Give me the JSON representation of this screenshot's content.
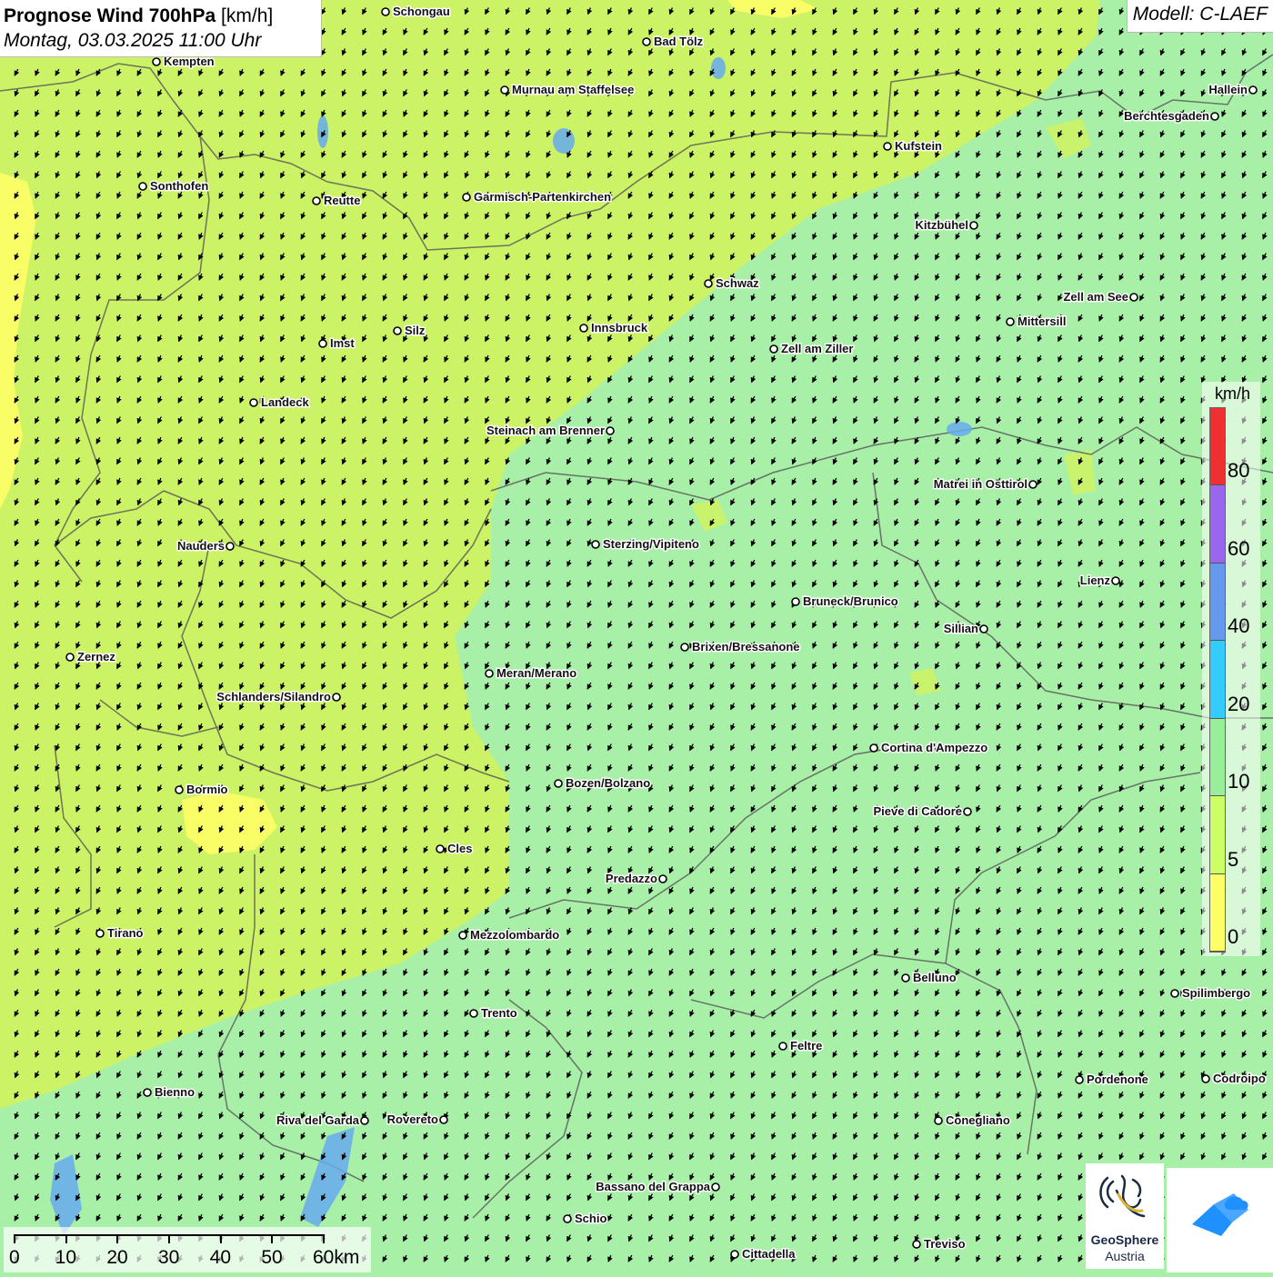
{
  "header": {
    "title_bold": "Prognose Wind 700hPa",
    "title_unit": " [km/h]",
    "subtitle": "Montag, 03.03.2025 11:00 Uhr",
    "model": "Modell: C-LAEF"
  },
  "legend": {
    "unit": "km/h",
    "ticks": [
      "80",
      "60",
      "40",
      "20",
      "10",
      "5",
      "0"
    ],
    "colors": [
      "#f03030",
      "#9966ee",
      "#6699ee",
      "#33ccff",
      "#99ee99",
      "#ccff66",
      "#ffff66"
    ]
  },
  "scalebar": {
    "labels": [
      "0",
      "10",
      "20",
      "30",
      "40",
      "50",
      "60km"
    ]
  },
  "logos": {
    "geosphere_name": "GeoSphere",
    "geosphere_sub": "Austria"
  },
  "map": {
    "background_colors": {
      "calm": "#ccf266",
      "light": "#ffff66",
      "moderate": "#a8f0a8"
    },
    "wind_direction": "from north-northeast (arrows point south-southwest)",
    "cities": [
      {
        "name": "Schongau"
      },
      {
        "name": "Bad Tölz"
      },
      {
        "name": "Kempten"
      },
      {
        "name": "Murnau am Staffelsee"
      },
      {
        "name": "Hallein"
      },
      {
        "name": "Berchtesgaden"
      },
      {
        "name": "Kufstein"
      },
      {
        "name": "Sonthofen"
      },
      {
        "name": "Reutte"
      },
      {
        "name": "Garmisch-Partenkirchen"
      },
      {
        "name": "Kitzbühel"
      },
      {
        "name": "Schwaz"
      },
      {
        "name": "Zell am See"
      },
      {
        "name": "Mittersill"
      },
      {
        "name": "Innsbruck"
      },
      {
        "name": "Silz"
      },
      {
        "name": "Imst"
      },
      {
        "name": "Zell am Ziller"
      },
      {
        "name": "Landeck"
      },
      {
        "name": "Steinach am Brenner"
      },
      {
        "name": "Matrei in Osttirol"
      },
      {
        "name": "Nauders"
      },
      {
        "name": "Sterzing/Vipiteno"
      },
      {
        "name": "Lienz"
      },
      {
        "name": "Bruneck/Brunico"
      },
      {
        "name": "Sillian"
      },
      {
        "name": "Brixen/Bressanone"
      },
      {
        "name": "Zernez"
      },
      {
        "name": "Meran/Merano"
      },
      {
        "name": "Schlanders/Silandro"
      },
      {
        "name": "Cortina d'Ampezzo"
      },
      {
        "name": "Bozen/Bolzano"
      },
      {
        "name": "Bormio"
      },
      {
        "name": "Pieve di Cadore"
      },
      {
        "name": "Cles"
      },
      {
        "name": "Predazzo"
      },
      {
        "name": "Tirano"
      },
      {
        "name": "Mezzolombardo"
      },
      {
        "name": "Belluno"
      },
      {
        "name": "Spilimbergo"
      },
      {
        "name": "Trento"
      },
      {
        "name": "Feltre"
      },
      {
        "name": "Pordenone"
      },
      {
        "name": "Codroipo"
      },
      {
        "name": "Bienno"
      },
      {
        "name": "Riva del Garda"
      },
      {
        "name": "Rovereto"
      },
      {
        "name": "Conegliano"
      },
      {
        "name": "Bassano del Grappa"
      },
      {
        "name": "Schio"
      },
      {
        "name": "Treviso"
      },
      {
        "name": "Cittadella"
      }
    ]
  }
}
